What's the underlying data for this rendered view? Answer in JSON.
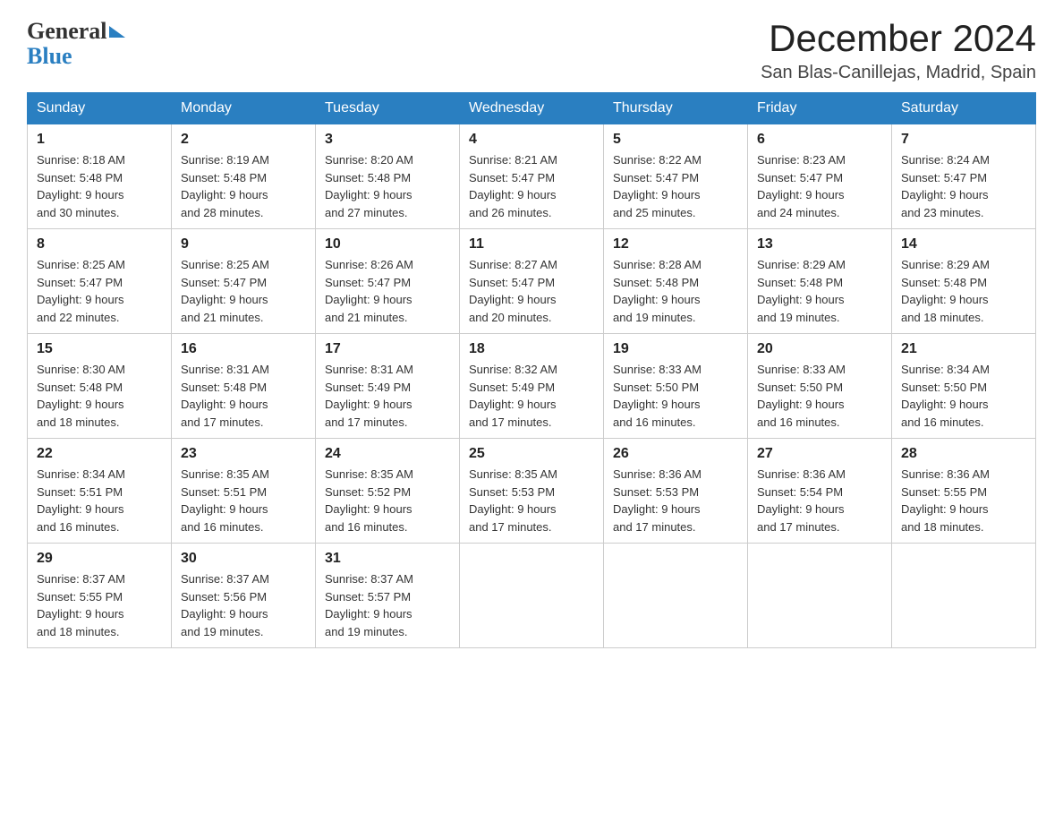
{
  "header": {
    "title": "December 2024",
    "subtitle": "San Blas-Canillejas, Madrid, Spain"
  },
  "logo": {
    "line1": "General",
    "line2": "Blue"
  },
  "columns": [
    "Sunday",
    "Monday",
    "Tuesday",
    "Wednesday",
    "Thursday",
    "Friday",
    "Saturday"
  ],
  "weeks": [
    [
      {
        "day": "1",
        "sunrise": "8:18 AM",
        "sunset": "5:48 PM",
        "daylight": "9 hours and 30 minutes."
      },
      {
        "day": "2",
        "sunrise": "8:19 AM",
        "sunset": "5:48 PM",
        "daylight": "9 hours and 28 minutes."
      },
      {
        "day": "3",
        "sunrise": "8:20 AM",
        "sunset": "5:48 PM",
        "daylight": "9 hours and 27 minutes."
      },
      {
        "day": "4",
        "sunrise": "8:21 AM",
        "sunset": "5:47 PM",
        "daylight": "9 hours and 26 minutes."
      },
      {
        "day": "5",
        "sunrise": "8:22 AM",
        "sunset": "5:47 PM",
        "daylight": "9 hours and 25 minutes."
      },
      {
        "day": "6",
        "sunrise": "8:23 AM",
        "sunset": "5:47 PM",
        "daylight": "9 hours and 24 minutes."
      },
      {
        "day": "7",
        "sunrise": "8:24 AM",
        "sunset": "5:47 PM",
        "daylight": "9 hours and 23 minutes."
      }
    ],
    [
      {
        "day": "8",
        "sunrise": "8:25 AM",
        "sunset": "5:47 PM",
        "daylight": "9 hours and 22 minutes."
      },
      {
        "day": "9",
        "sunrise": "8:25 AM",
        "sunset": "5:47 PM",
        "daylight": "9 hours and 21 minutes."
      },
      {
        "day": "10",
        "sunrise": "8:26 AM",
        "sunset": "5:47 PM",
        "daylight": "9 hours and 21 minutes."
      },
      {
        "day": "11",
        "sunrise": "8:27 AM",
        "sunset": "5:47 PM",
        "daylight": "9 hours and 20 minutes."
      },
      {
        "day": "12",
        "sunrise": "8:28 AM",
        "sunset": "5:48 PM",
        "daylight": "9 hours and 19 minutes."
      },
      {
        "day": "13",
        "sunrise": "8:29 AM",
        "sunset": "5:48 PM",
        "daylight": "9 hours and 19 minutes."
      },
      {
        "day": "14",
        "sunrise": "8:29 AM",
        "sunset": "5:48 PM",
        "daylight": "9 hours and 18 minutes."
      }
    ],
    [
      {
        "day": "15",
        "sunrise": "8:30 AM",
        "sunset": "5:48 PM",
        "daylight": "9 hours and 18 minutes."
      },
      {
        "day": "16",
        "sunrise": "8:31 AM",
        "sunset": "5:48 PM",
        "daylight": "9 hours and 17 minutes."
      },
      {
        "day": "17",
        "sunrise": "8:31 AM",
        "sunset": "5:49 PM",
        "daylight": "9 hours and 17 minutes."
      },
      {
        "day": "18",
        "sunrise": "8:32 AM",
        "sunset": "5:49 PM",
        "daylight": "9 hours and 17 minutes."
      },
      {
        "day": "19",
        "sunrise": "8:33 AM",
        "sunset": "5:50 PM",
        "daylight": "9 hours and 16 minutes."
      },
      {
        "day": "20",
        "sunrise": "8:33 AM",
        "sunset": "5:50 PM",
        "daylight": "9 hours and 16 minutes."
      },
      {
        "day": "21",
        "sunrise": "8:34 AM",
        "sunset": "5:50 PM",
        "daylight": "9 hours and 16 minutes."
      }
    ],
    [
      {
        "day": "22",
        "sunrise": "8:34 AM",
        "sunset": "5:51 PM",
        "daylight": "9 hours and 16 minutes."
      },
      {
        "day": "23",
        "sunrise": "8:35 AM",
        "sunset": "5:51 PM",
        "daylight": "9 hours and 16 minutes."
      },
      {
        "day": "24",
        "sunrise": "8:35 AM",
        "sunset": "5:52 PM",
        "daylight": "9 hours and 16 minutes."
      },
      {
        "day": "25",
        "sunrise": "8:35 AM",
        "sunset": "5:53 PM",
        "daylight": "9 hours and 17 minutes."
      },
      {
        "day": "26",
        "sunrise": "8:36 AM",
        "sunset": "5:53 PM",
        "daylight": "9 hours and 17 minutes."
      },
      {
        "day": "27",
        "sunrise": "8:36 AM",
        "sunset": "5:54 PM",
        "daylight": "9 hours and 17 minutes."
      },
      {
        "day": "28",
        "sunrise": "8:36 AM",
        "sunset": "5:55 PM",
        "daylight": "9 hours and 18 minutes."
      }
    ],
    [
      {
        "day": "29",
        "sunrise": "8:37 AM",
        "sunset": "5:55 PM",
        "daylight": "9 hours and 18 minutes."
      },
      {
        "day": "30",
        "sunrise": "8:37 AM",
        "sunset": "5:56 PM",
        "daylight": "9 hours and 19 minutes."
      },
      {
        "day": "31",
        "sunrise": "8:37 AM",
        "sunset": "5:57 PM",
        "daylight": "9 hours and 19 minutes."
      },
      null,
      null,
      null,
      null
    ]
  ],
  "labels": {
    "sunrise_prefix": "Sunrise: ",
    "sunset_prefix": "Sunset: ",
    "daylight_prefix": "Daylight: "
  }
}
